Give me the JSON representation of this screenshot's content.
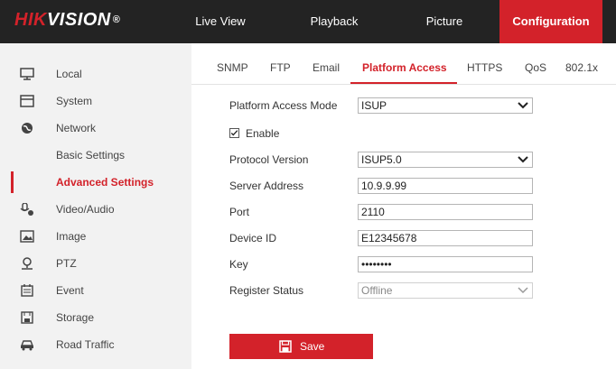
{
  "brand": {
    "part1": "HIK",
    "part2": "VISION",
    "reg": "®"
  },
  "nav": [
    {
      "label": "Live View"
    },
    {
      "label": "Playback"
    },
    {
      "label": "Picture"
    },
    {
      "label": "Configuration"
    }
  ],
  "sidebar": {
    "items": [
      {
        "label": "Local",
        "icon": "monitor-icon"
      },
      {
        "label": "System",
        "icon": "window-icon"
      },
      {
        "label": "Network",
        "icon": "globe-icon"
      },
      {
        "label": "Basic Settings"
      },
      {
        "label": "Advanced Settings"
      },
      {
        "label": "Video/Audio",
        "icon": "microphone-camera-icon"
      },
      {
        "label": "Image",
        "icon": "image-icon"
      },
      {
        "label": "PTZ",
        "icon": "ptz-camera-icon"
      },
      {
        "label": "Event",
        "icon": "calendar-icon"
      },
      {
        "label": "Storage",
        "icon": "disk-icon"
      },
      {
        "label": "Road Traffic",
        "icon": "car-icon"
      }
    ]
  },
  "tabs": [
    {
      "label": "SNMP"
    },
    {
      "label": "FTP"
    },
    {
      "label": "Email"
    },
    {
      "label": "Platform Access"
    },
    {
      "label": "HTTPS"
    },
    {
      "label": "QoS"
    },
    {
      "label": "802.1x"
    }
  ],
  "form": {
    "access_mode_label": "Platform Access Mode",
    "access_mode_value": "ISUP",
    "enable_label": "Enable",
    "enable_checked": true,
    "protocol_label": "Protocol Version",
    "protocol_value": "ISUP5.0",
    "server_label": "Server Address",
    "server_value": "10.9.9.99",
    "port_label": "Port",
    "port_value": "2110",
    "device_label": "Device ID",
    "device_value": "E12345678",
    "key_label": "Key",
    "key_value": "••••••••",
    "status_label": "Register Status",
    "status_value": "Offline",
    "save_label": "Save"
  },
  "colors": {
    "accent": "#d3222a",
    "topbar": "#232323"
  }
}
